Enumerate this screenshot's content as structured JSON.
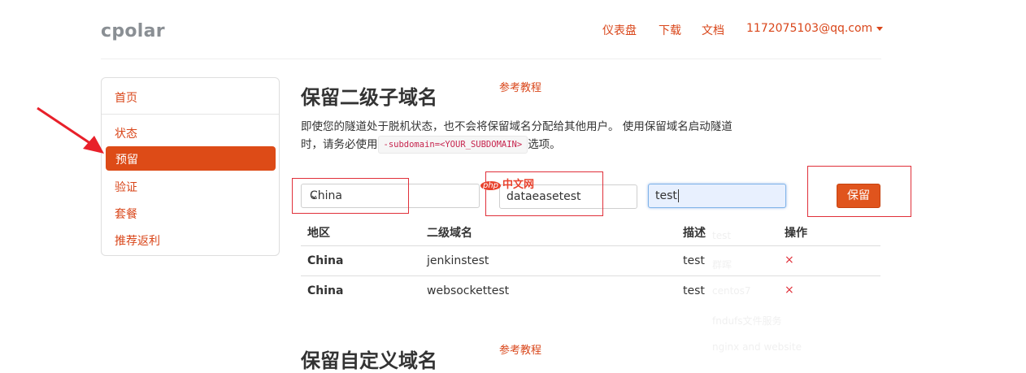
{
  "brand": "cpolar",
  "topnav": {
    "dashboard": "仪表盘",
    "download": "下载",
    "docs": "文档",
    "account": "1172075103@qq.com"
  },
  "sidebar": {
    "items": [
      {
        "label": "首页"
      },
      {
        "label": "状态"
      },
      {
        "label": "预留",
        "active": true
      },
      {
        "label": "验证"
      },
      {
        "label": "套餐"
      },
      {
        "label": "推荐返利"
      }
    ]
  },
  "section1": {
    "title": "保留二级子域名",
    "tutorial_link": "参考教程",
    "desc_part1": "即使您的隧道处于脱机状态，也不会将保留域名分配给其他用户。 使用保留域名启动隧道",
    "desc_part2": "时，请务必使用",
    "desc_code": "-subdomain=<YOUR_SUBDOMAIN>",
    "desc_part3": "选项。"
  },
  "form": {
    "region_value": "China",
    "subdomain_value": "dataeasetest",
    "description_value": "test",
    "reserve_button": "保留"
  },
  "table": {
    "headers": [
      "地区",
      "二级域名",
      "描述",
      "操作"
    ],
    "rows": [
      {
        "region": "China",
        "subdomain": "jenkinstest",
        "description": "test",
        "action": "×"
      },
      {
        "region": "China",
        "subdomain": "websockettest",
        "description": "test",
        "action": "×"
      }
    ]
  },
  "autocomplete_ghost": [
    "test",
    "群晖",
    "centos7",
    "fndufs文件服务",
    "nginx and website"
  ],
  "section2": {
    "title": "保留自定义域名",
    "tutorial_link": "参考教程"
  },
  "watermark": {
    "badge": "php",
    "text": "中文网"
  },
  "colors": {
    "accent": "#d9461a",
    "annotation": "#e0303a"
  }
}
